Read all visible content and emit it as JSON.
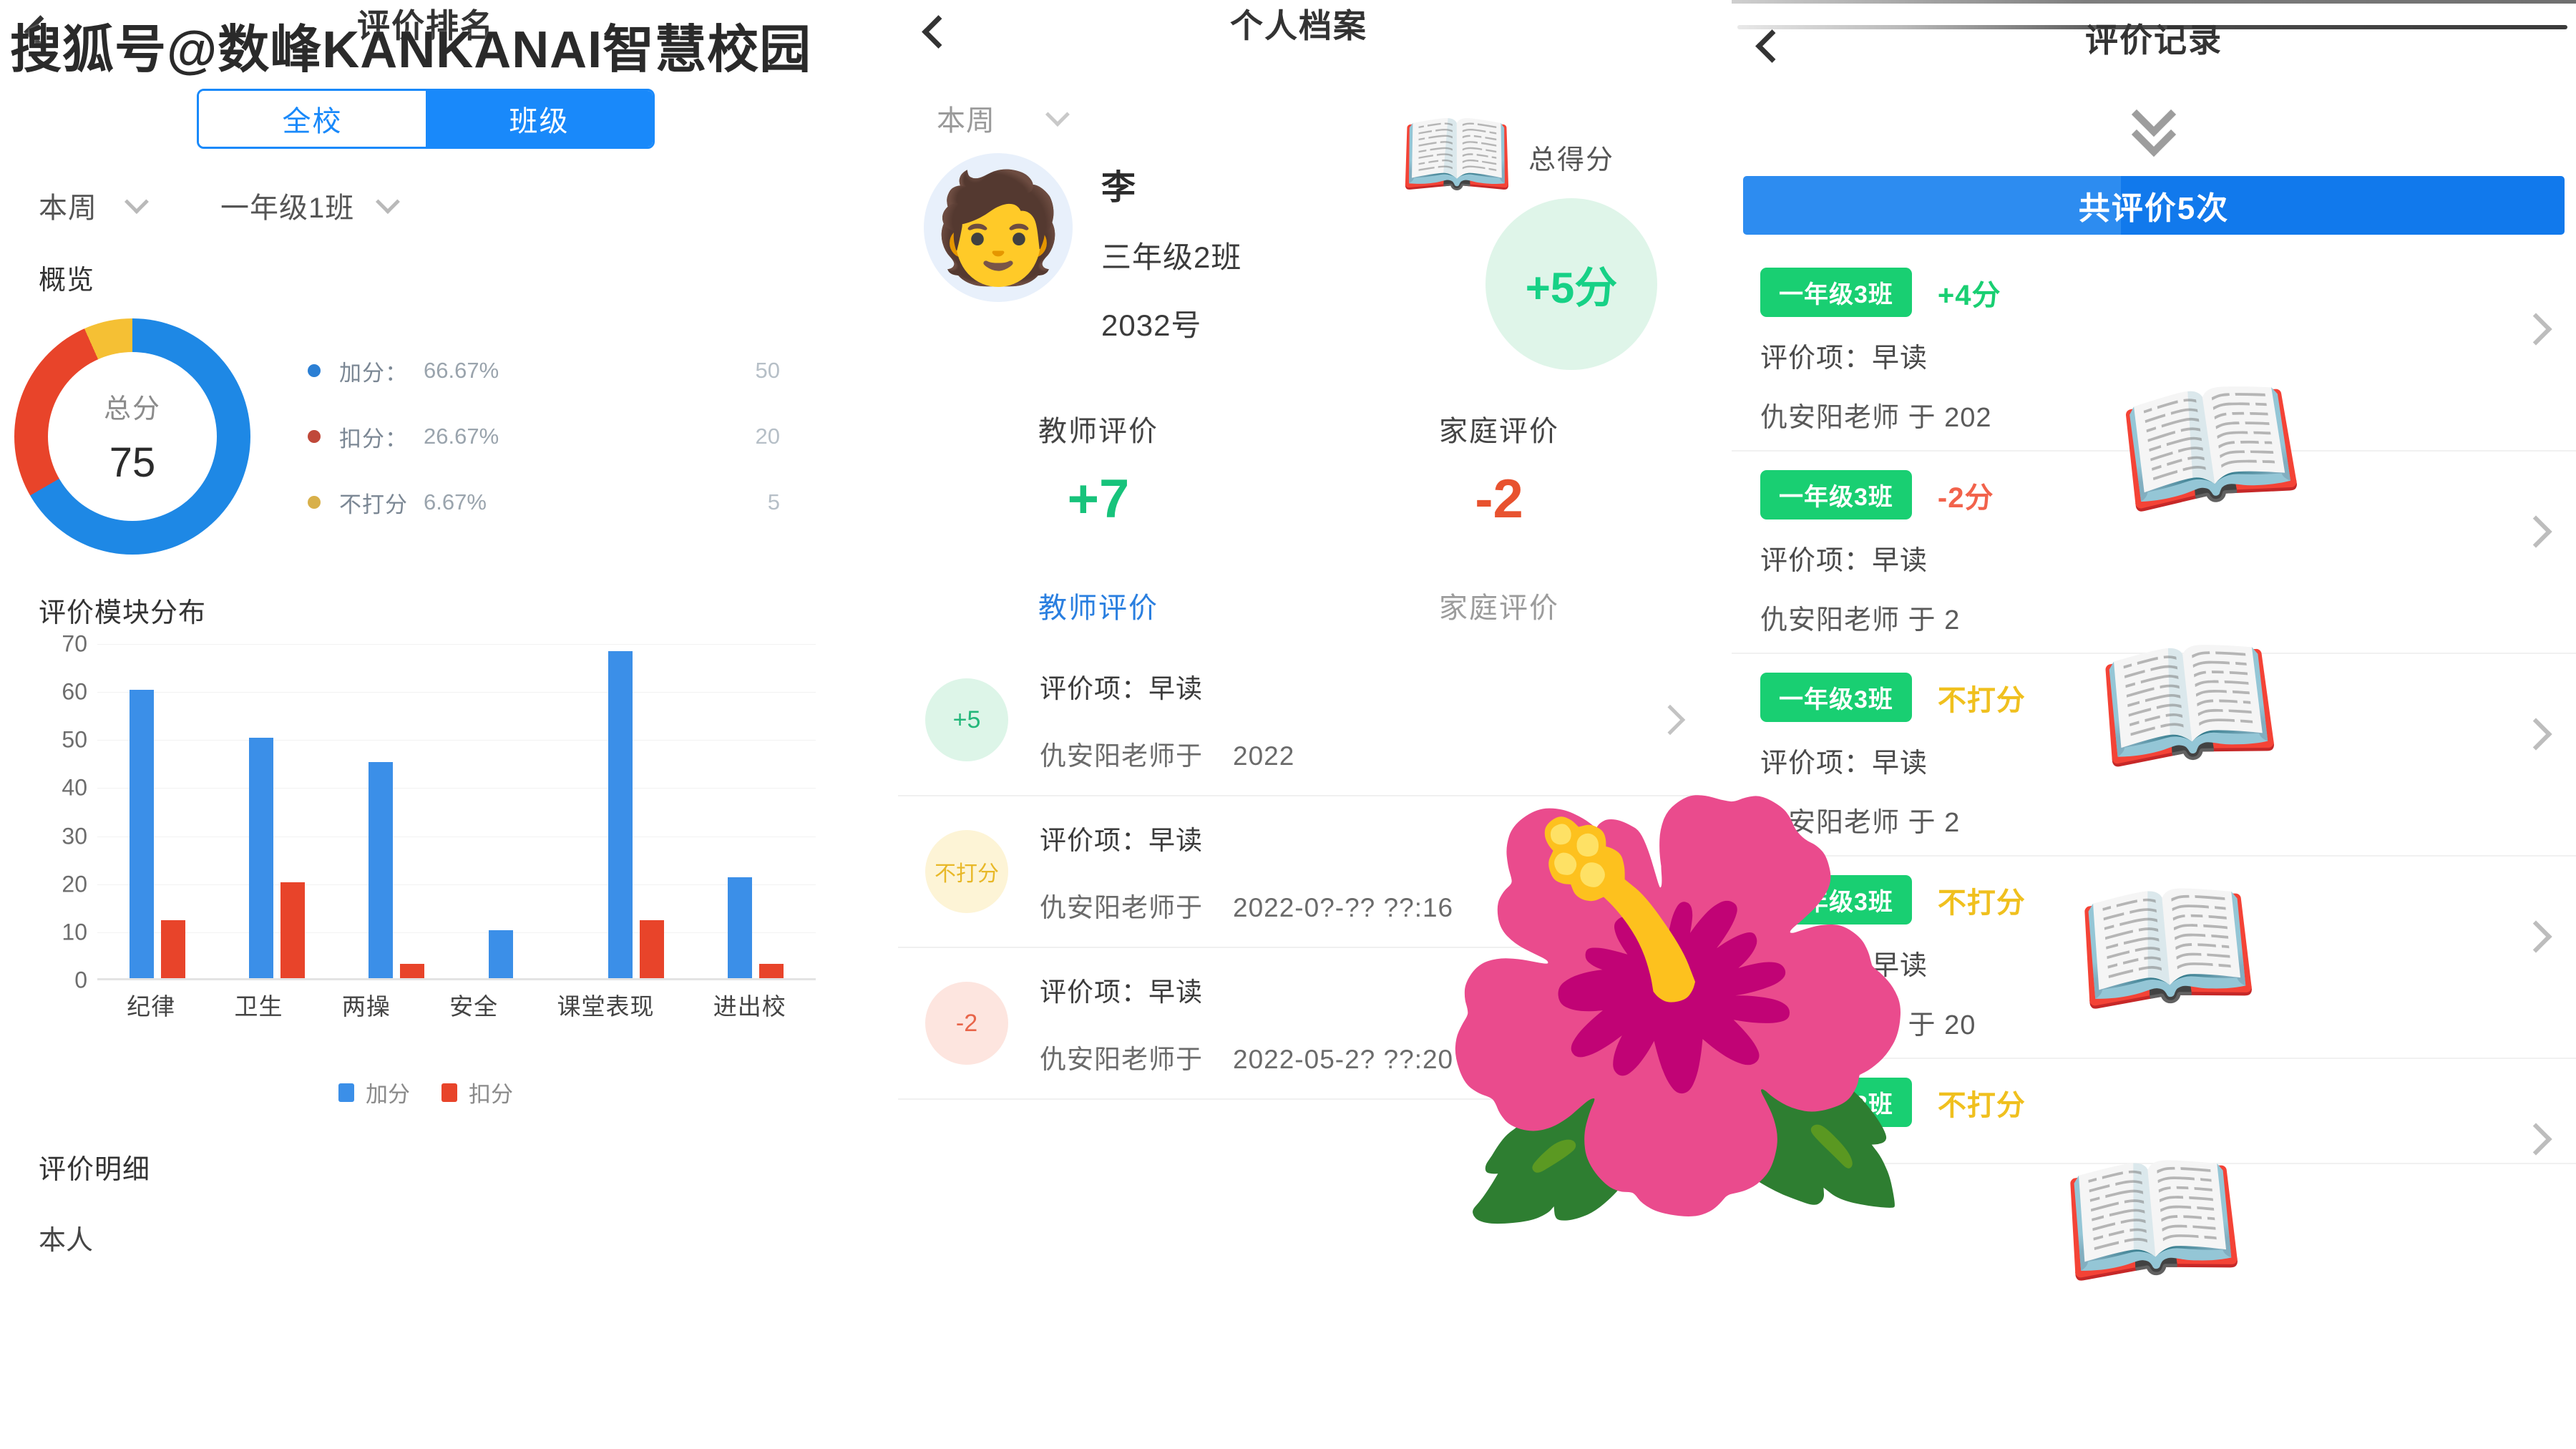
{
  "watermark": {
    "text": "搜狐号@数峰KANKANAI智慧校园"
  },
  "colors": {
    "primary_blue": "#1989fa",
    "bar_blue": "#3b8fe8",
    "bar_red": "#e8442a",
    "donut_yellow": "#f5c034",
    "green": "#19cf72",
    "score_green": "#17c37b",
    "score_red": "#e8522f"
  },
  "left_panel": {
    "nav": {
      "back_icon": "chevron-left-icon",
      "title": "评价排名"
    },
    "segment": {
      "options": [
        "全校",
        "班级"
      ],
      "selected": "班级"
    },
    "filters": [
      {
        "label": "本周",
        "icon": "chevron-down-icon"
      },
      {
        "label": "一年级1班",
        "icon": "chevron-down-icon"
      }
    ],
    "overview_title": "概览",
    "donut": {
      "center_label": "总分",
      "center_value": "75",
      "legend": [
        {
          "name": "加分",
          "pct": "66.67%",
          "count": "50",
          "color": "#2b7fd4"
        },
        {
          "name": "扣分",
          "pct": "26.67%",
          "count": "20",
          "color": "#c0493a"
        },
        {
          "name": "不打分",
          "pct": "6.67%",
          "count": "5",
          "color": "#d8b04a"
        }
      ]
    },
    "chart_title": "评价模块分布",
    "chart_legend": [
      {
        "label": "加分",
        "color": "#3b8fe8"
      },
      {
        "label": "扣分",
        "color": "#e8442a"
      }
    ],
    "detail_title": "评价明细",
    "detail_peek": "本人"
  },
  "chart_data": [
    {
      "type": "pie",
      "title": "概览",
      "center_label": "总分",
      "center_value": 75,
      "labels": [
        "加分",
        "扣分",
        "不打分"
      ],
      "values": [
        50,
        20,
        5
      ],
      "percents": [
        66.67,
        26.67,
        6.67
      ],
      "colors": [
        "#1e88e5",
        "#e8442a",
        "#f5c034"
      ],
      "legend": "right"
    },
    {
      "type": "bar",
      "title": "评价模块分布",
      "categories": [
        "纪律",
        "卫生",
        "两操",
        "安全",
        "课堂表现",
        "进出校"
      ],
      "series": [
        {
          "name": "加分",
          "color": "#3b8fe8",
          "values": [
            60,
            50,
            45,
            10,
            68,
            21
          ]
        },
        {
          "name": "扣分",
          "color": "#e8442a",
          "values": [
            12,
            20,
            3,
            0,
            12,
            3
          ]
        }
      ],
      "xlabel": "",
      "ylabel": "",
      "ylim": [
        0,
        70
      ],
      "yticks": [
        0,
        10,
        20,
        30,
        40,
        50,
        60,
        70
      ],
      "grid": true,
      "legend": "bottom"
    }
  ],
  "mid_panel": {
    "nav": {
      "back_icon": "chevron-left-icon",
      "title": "个人档案"
    },
    "filter": {
      "label": "本周",
      "icon": "chevron-down-icon"
    },
    "student": {
      "avatar_icon": "student-avatar",
      "name": "李",
      "class": "三年级2班",
      "number": "2032号"
    },
    "total": {
      "label": "总得分",
      "value": "+5分"
    },
    "scores": [
      {
        "label": "教师评价",
        "value": "+7",
        "sign": "pos"
      },
      {
        "label": "家庭评价",
        "value": "-2",
        "sign": "neg"
      }
    ],
    "tabs": [
      {
        "label": "教师评价",
        "active": true
      },
      {
        "label": "家庭评价",
        "active": false
      }
    ],
    "list": [
      {
        "badge": "+5",
        "badge_color": "green",
        "item": "评价项：早读",
        "teacher": "仇安阳老师于",
        "date": "2022",
        "chevron_icon": "chevron-right-icon"
      },
      {
        "badge": "不打分",
        "badge_color": "yellow",
        "item": "评价项：早读",
        "teacher": "仇安阳老师于",
        "date": "2022-0?-?? ??:16",
        "chevron_icon": "chevron-right-icon"
      },
      {
        "badge": "-2",
        "badge_color": "red",
        "item": "评价项：早读",
        "teacher": "仇安阳老师于",
        "date": "2022-05-2?  ??:20",
        "chevron_icon": "chevron-right-icon"
      }
    ]
  },
  "right_panel": {
    "nav": {
      "back_icon": "chevron-left-icon",
      "title": "评价记录"
    },
    "expand_icon": "double-chevron-down-icon",
    "count_bar": "共评价5次",
    "records": [
      {
        "class": "一年级3班",
        "score": "+4分",
        "score_type": "pos",
        "item": "评价项：早读",
        "meta": "仇安阳老师 于 202",
        "chevron_icon": "chevron-right-icon"
      },
      {
        "class": "一年级3班",
        "score": "-2分",
        "score_type": "neg",
        "item": "评价项：早读",
        "meta": "仇安阳老师 于 2",
        "chevron_icon": "chevron-right-icon"
      },
      {
        "class": "一年级3班",
        "score": "不打分",
        "score_type": "none",
        "item": "评价项：早读",
        "meta": "仇安阳老师 于 2",
        "chevron_icon": "chevron-right-icon"
      },
      {
        "class": "一年级3班",
        "score": "不打分",
        "score_type": "none",
        "item": "评价项：早读",
        "meta": "仇安阳老师 于 20",
        "chevron_icon": "chevron-right-icon"
      },
      {
        "class": "一年级3班",
        "score": "不打分",
        "score_type": "none",
        "item": "",
        "meta": "",
        "chevron_icon": "chevron-right-icon"
      }
    ]
  },
  "stickers": [
    {
      "name": "open-book-sticker",
      "glyph": "📖"
    },
    {
      "name": "flower-sticker",
      "glyph": "🌺"
    }
  ]
}
